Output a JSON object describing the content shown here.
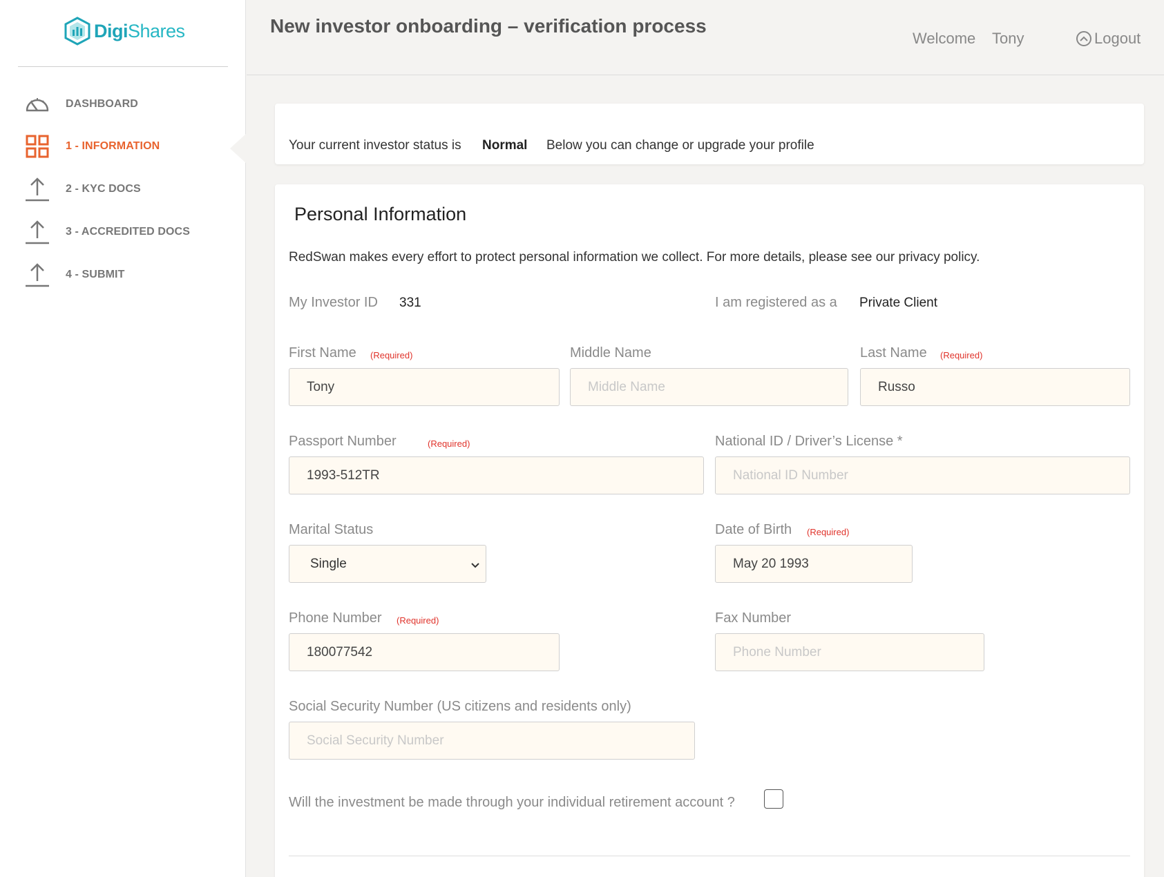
{
  "brand": {
    "part1": "Digi",
    "part2": "Shares",
    "color1": "#1fa5b8",
    "color2": "#27b7c4"
  },
  "sidebar": {
    "items": [
      {
        "label": "DASHBOARD",
        "icon": "speedometer-icon",
        "active": false
      },
      {
        "label": "1 - INFORMATION",
        "icon": "grid-icon",
        "active": true
      },
      {
        "label": "2 - KYC DOCS",
        "icon": "upload-icon",
        "active": false
      },
      {
        "label": "3 - ACCREDITED DOCS",
        "icon": "upload-icon",
        "active": false
      },
      {
        "label": "4 - SUBMIT",
        "icon": "upload-icon",
        "active": false
      }
    ],
    "active_color": "#e8632e"
  },
  "header": {
    "title": "New investor onboarding – verification process",
    "welcome": "Welcome",
    "username": "Tony",
    "logout": "Logout"
  },
  "status": {
    "prefix": "Your current investor status is",
    "value": "Normal",
    "suffix": "Below you can change or upgrade your profile"
  },
  "personal": {
    "title": "Personal Information",
    "privacy": "RedSwan makes every effort to protect personal information we collect.  For more details, please see our privacy policy.",
    "investor_id_label": "My Investor ID",
    "investor_id": "331",
    "registered_label": "I am registered as a",
    "registered_value": "Private Client",
    "required_tag": "(Required)",
    "first_name": {
      "label": "First Name",
      "value": "Tony",
      "placeholder": "First Name"
    },
    "middle_name": {
      "label": "Middle Name",
      "value": "",
      "placeholder": "Middle Name"
    },
    "last_name": {
      "label": "Last Name",
      "value": "Russo",
      "placeholder": "Last Name"
    },
    "passport": {
      "label": "Passport Number",
      "value": "1993-512TR",
      "placeholder": "Passport Number"
    },
    "national_id": {
      "label": "National ID / Driver’s License *",
      "value": "",
      "placeholder": "National ID Number"
    },
    "marital": {
      "label": "Marital Status",
      "value": "Single"
    },
    "dob": {
      "label": "Date of Birth",
      "value": "May 20 1993",
      "placeholder": "Date of Birth"
    },
    "phone": {
      "label": "Phone Number",
      "value": "180077542",
      "placeholder": "Phone Number"
    },
    "fax": {
      "label": "Fax Number",
      "value": "",
      "placeholder": "Phone Number"
    },
    "ssn": {
      "label": "Social Security Number (US citizens and residents only)",
      "value": "",
      "placeholder": "Social Security Number"
    },
    "ira_question": "Will the investment be made through your individual retirement account ?",
    "ira_checked": false
  }
}
